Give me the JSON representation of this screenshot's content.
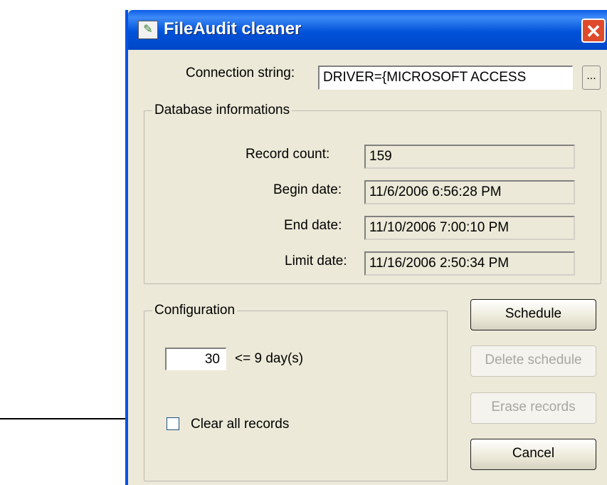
{
  "window": {
    "title": "FileAudit cleaner",
    "close_label": "✕"
  },
  "connection": {
    "label": "Connection string:",
    "value": "DRIVER={MICROSOFT ACCESS",
    "browse_label": "..."
  },
  "database": {
    "legend": "Database informations",
    "rows": [
      {
        "label": "Record count:",
        "value": "159"
      },
      {
        "label": "Begin date:",
        "value": "11/6/2006 6:56:28 PM"
      },
      {
        "label": "End date:",
        "value": "11/10/2006 7:00:10 PM"
      },
      {
        "label": "Limit date:",
        "value": "11/16/2006 2:50:34 PM"
      }
    ]
  },
  "configuration": {
    "legend": "Configuration",
    "days_value": "30",
    "days_hint": "<= 9 day(s)",
    "clear_all_label": "Clear all records",
    "clear_all_checked": false
  },
  "buttons": {
    "schedule": "Schedule",
    "delete_schedule": "Delete schedule",
    "erase_records": "Erase records",
    "cancel": "Cancel"
  }
}
